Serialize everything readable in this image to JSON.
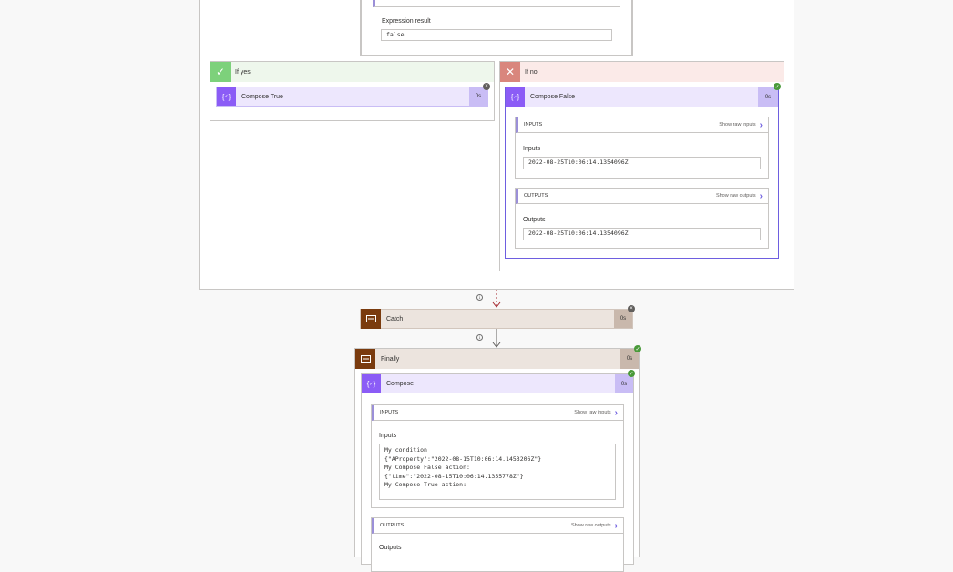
{
  "condition_panel": {
    "expression_result_label": "Expression result",
    "expression_result_value": "false"
  },
  "if_yes": {
    "label": "If yes",
    "action": {
      "title": "Compose True",
      "duration": "0s"
    }
  },
  "if_no": {
    "label": "If no",
    "action": {
      "title": "Compose False",
      "duration": "0s",
      "inputs_header": "INPUTS",
      "show_inputs": "Show raw inputs",
      "inputs_label": "Inputs",
      "inputs_value": "2022-08-25T10:06:14.1354096Z",
      "outputs_header": "OUTPUTS",
      "show_outputs": "Show raw outputs",
      "outputs_label": "Outputs",
      "outputs_value": "2022-08-25T10:06:14.1354096Z"
    }
  },
  "catch": {
    "title": "Catch",
    "duration": "0s"
  },
  "finally": {
    "title": "Finally",
    "duration": "0s",
    "compose": {
      "title": "Compose",
      "duration": "0s",
      "inputs_header": "INPUTS",
      "show_inputs": "Show raw inputs",
      "inputs_label": "Inputs",
      "inputs_lines": [
        "My condition",
        "{\"AProperty\":\"2022-08-15T10:06:14.1453206Z\"}",
        "My Compose False action:",
        "{\"time\":\"2022-08-15T10:06:14.1355778Z\"}",
        "My Compose True action:"
      ],
      "outputs_header": "OUTPUTS",
      "show_outputs": "Show raw outputs",
      "outputs_label": "Outputs"
    }
  },
  "colors": {
    "compose_purple": "#8b5cf6",
    "compose_bg": "#ede7fd",
    "scope_brown": "#7a3b0e",
    "scope_bg": "#ece4de",
    "yes_green": "#7dd17b",
    "no_red": "#d9867d"
  }
}
